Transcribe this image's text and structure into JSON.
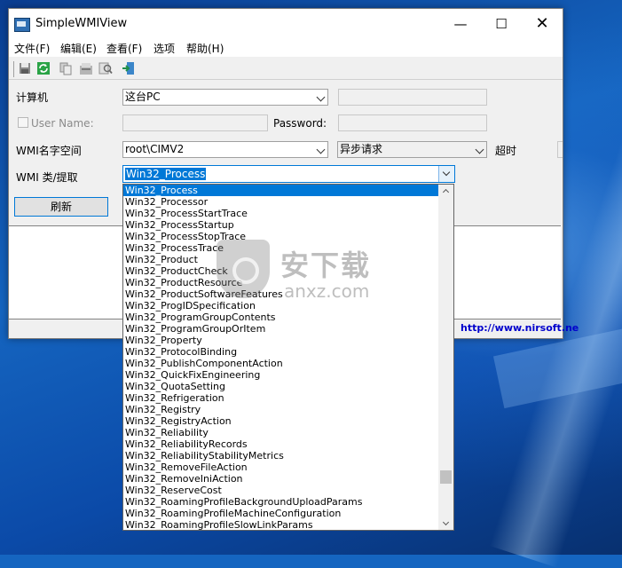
{
  "window": {
    "title": "SimpleWMIView",
    "min_glyph": "—",
    "max_glyph": "☐",
    "close_glyph": "✕"
  },
  "menu": [
    "文件(F)",
    "编辑(E)",
    "查看(F)",
    "选项",
    "帮助(H)"
  ],
  "toolbar": {
    "icons": [
      "save-icon",
      "refresh-icon",
      "copy-icon",
      "properties-icon",
      "find-icon",
      "exit-icon"
    ]
  },
  "form": {
    "computer_label": "计算机",
    "computer_value": "这台PC",
    "username_label": "User Name:",
    "password_label": "Password:",
    "namespace_label": "WMI名字空间",
    "namespace_value": "root\\CIMV2",
    "request_mode_value": "异步请求",
    "timeout_label": "超时",
    "class_label": "WMI 类/提取",
    "class_value": "Win32_Process",
    "refresh_label": "刷新"
  },
  "status": {
    "link": "http://www.nirsoft.ne"
  },
  "dropdown": {
    "selected_index": 0,
    "items": [
      "Win32_Process",
      "Win32_Processor",
      "Win32_ProcessStartTrace",
      "Win32_ProcessStartup",
      "Win32_ProcessStopTrace",
      "Win32_ProcessTrace",
      "Win32_Product",
      "Win32_ProductCheck",
      "Win32_ProductResource",
      "Win32_ProductSoftwareFeatures",
      "Win32_ProgIDSpecification",
      "Win32_ProgramGroupContents",
      "Win32_ProgramGroupOrItem",
      "Win32_Property",
      "Win32_ProtocolBinding",
      "Win32_PublishComponentAction",
      "Win32_QuickFixEngineering",
      "Win32_QuotaSetting",
      "Win32_Refrigeration",
      "Win32_Registry",
      "Win32_RegistryAction",
      "Win32_Reliability",
      "Win32_ReliabilityRecords",
      "Win32_ReliabilityStabilityMetrics",
      "Win32_RemoveFileAction",
      "Win32_RemoveIniAction",
      "Win32_ReserveCost",
      "Win32_RoamingProfileBackgroundUploadParams",
      "Win32_RoamingProfileMachineConfiguration",
      "Win32_RoamingProfileSlowLinkParams"
    ]
  },
  "watermark": {
    "title": "安下载",
    "subtitle": "anxz.com"
  },
  "colors": {
    "accent": "#0078d7",
    "link": "#0000cc"
  }
}
